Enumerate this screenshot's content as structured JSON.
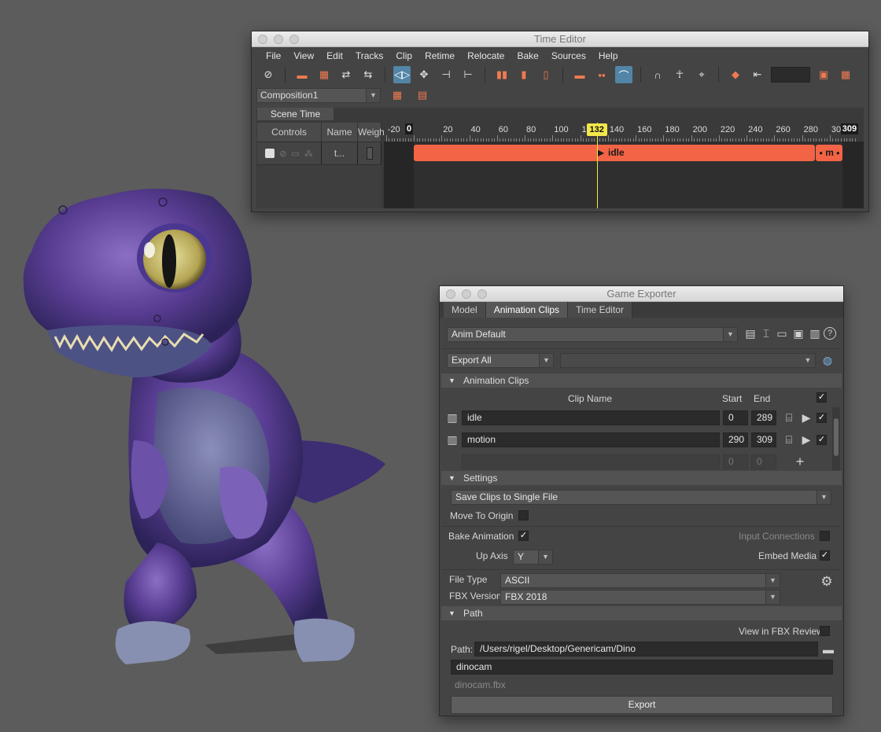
{
  "time_editor": {
    "title": "Time Editor",
    "menu": [
      "File",
      "View",
      "Edit",
      "Tracks",
      "Clip",
      "Retime",
      "Relocate",
      "Bake",
      "Sources",
      "Help"
    ],
    "composition": "Composition1",
    "scene_time_tab": "Scene Time",
    "columns": {
      "controls": "Controls",
      "name": "Name",
      "weight": "Weigh"
    },
    "row_name": "t...",
    "ruler_labels": [
      "-20",
      "0",
      "20",
      "40",
      "60",
      "80",
      "100",
      "120",
      "140",
      "160",
      "180",
      "200",
      "220",
      "240",
      "260",
      "280",
      "30"
    ],
    "start_frame": "0",
    "end_frame": "309",
    "current_frame": "132",
    "clips": [
      {
        "label": "idle",
        "start": 0,
        "end": 289
      },
      {
        "label": "m",
        "start": 290,
        "end": 309
      }
    ]
  },
  "game_exporter": {
    "title": "Game Exporter",
    "tabs": [
      "Model",
      "Animation Clips",
      "Time Editor"
    ],
    "preset": "Anim Default",
    "export_mode": "Export All",
    "sections": {
      "clips": "Animation Clips",
      "settings": "Settings",
      "path": "Path"
    },
    "clip_table": {
      "header_name": "Clip Name",
      "header_start": "Start",
      "header_end": "End",
      "rows": [
        {
          "name": "idle",
          "start": "0",
          "end": "289"
        },
        {
          "name": "motion",
          "start": "290",
          "end": "309"
        }
      ],
      "new_start": "0",
      "new_end": "0"
    },
    "settings": {
      "save_mode": "Save Clips to Single File",
      "move_to_origin": "Move To Origin",
      "bake_animation": "Bake Animation",
      "input_connections": "Input Connections",
      "up_axis_label": "Up Axis",
      "up_axis_value": "Y",
      "embed_media": "Embed Media",
      "file_type_label": "File Type",
      "file_type_value": "ASCII",
      "fbx_version_label": "FBX Version",
      "fbx_version_value": "FBX 2018"
    },
    "path": {
      "view_in_review": "View in FBX Review",
      "path_label": "Path:",
      "path_value": "/Users/rigel/Desktop/Genericam/Dino",
      "file_name": "dinocam",
      "file_preview": "dinocam.fbx"
    },
    "export_button": "Export"
  }
}
